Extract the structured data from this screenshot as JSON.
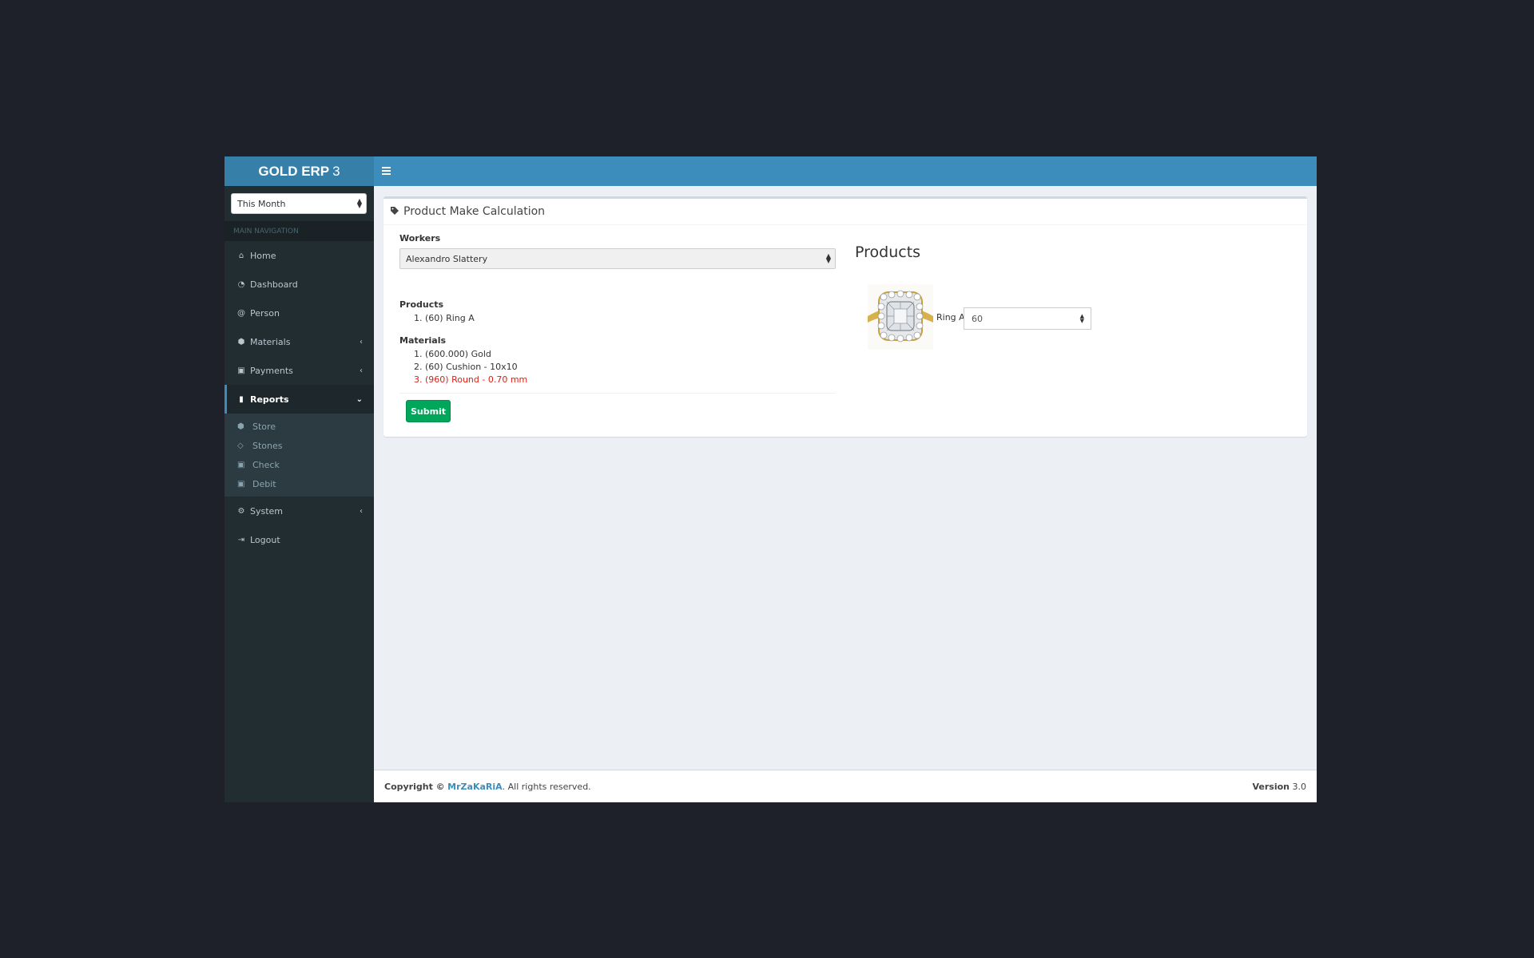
{
  "app": {
    "brand_bold": "GOLD ERP",
    "brand_version": "3"
  },
  "sidebar": {
    "period": "This Month",
    "nav_header": "MAIN NAVIGATION",
    "items": [
      {
        "label": "Home",
        "icon": "home-icon"
      },
      {
        "label": "Dashboard",
        "icon": "dashboard-icon"
      },
      {
        "label": "Person",
        "icon": "at-icon"
      },
      {
        "label": "Materials",
        "icon": "cubes-icon"
      },
      {
        "label": "Payments",
        "icon": "money-icon"
      },
      {
        "label": "Reports",
        "icon": "bookmark-icon"
      },
      {
        "label": "System",
        "icon": "gear-icon"
      },
      {
        "label": "Logout",
        "icon": "sign-out-icon"
      }
    ],
    "reports_sub": [
      {
        "label": "Store",
        "icon": "cubes-icon"
      },
      {
        "label": "Stones",
        "icon": "diamond-icon"
      },
      {
        "label": "Check",
        "icon": "money-icon"
      },
      {
        "label": "Debit",
        "icon": "money-icon"
      }
    ]
  },
  "box": {
    "title": "Product Make Calculation",
    "workers_label": "Workers",
    "worker_selected": "Alexandro Slattery",
    "products_label": "Products",
    "products": [
      "(60) Ring A"
    ],
    "materials_label": "Materials",
    "materials": [
      "(600.000) Gold",
      "(60) Cushion - 10x10",
      "(960) Round - 0.70 mm"
    ],
    "submit_label": "Submit",
    "products_heading": "Products",
    "product_name": "Ring A",
    "product_qty": "60"
  },
  "footer": {
    "copyright_prefix": "Copyright ©",
    "author": "MrZaKaRiA",
    "suffix": ". All rights reserved.",
    "version_label": "Version",
    "version": "3.0"
  },
  "colors": {
    "header": "#3c8dbc",
    "logo": "#367fa9",
    "sidebar": "#222d32",
    "success": "#00a65a",
    "error": "#dd1f12"
  }
}
